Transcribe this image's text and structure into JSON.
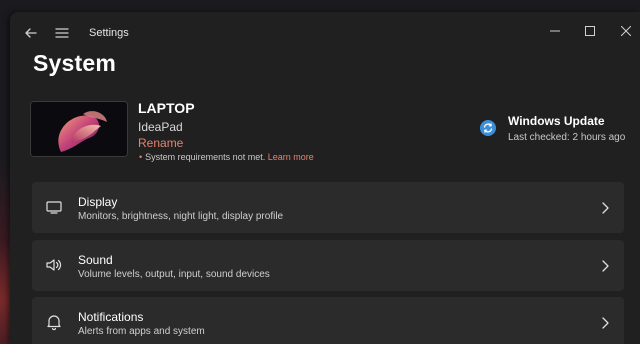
{
  "app": {
    "title": "Settings"
  },
  "page": {
    "title": "System"
  },
  "device": {
    "name": "LAPTOP",
    "model": "IdeaPad",
    "rename_label": "Rename",
    "requirements_text": "System requirements not met.",
    "learn_more_label": "Learn more"
  },
  "windows_update": {
    "title": "Windows Update",
    "last_checked": "Last checked: 2 hours ago"
  },
  "cards": [
    {
      "title": "Display",
      "subtitle": "Monitors, brightness, night light, display profile",
      "icon": "monitor-icon"
    },
    {
      "title": "Sound",
      "subtitle": "Volume levels, output, input, sound devices",
      "icon": "speaker-icon"
    },
    {
      "title": "Notifications",
      "subtitle": "Alerts from apps and system",
      "icon": "bell-icon"
    }
  ],
  "colors": {
    "accent_link": "#e9806a",
    "window_bg": "#202020",
    "card_bg": "#2b2b2b",
    "update_blue": "#3b8ed8"
  }
}
